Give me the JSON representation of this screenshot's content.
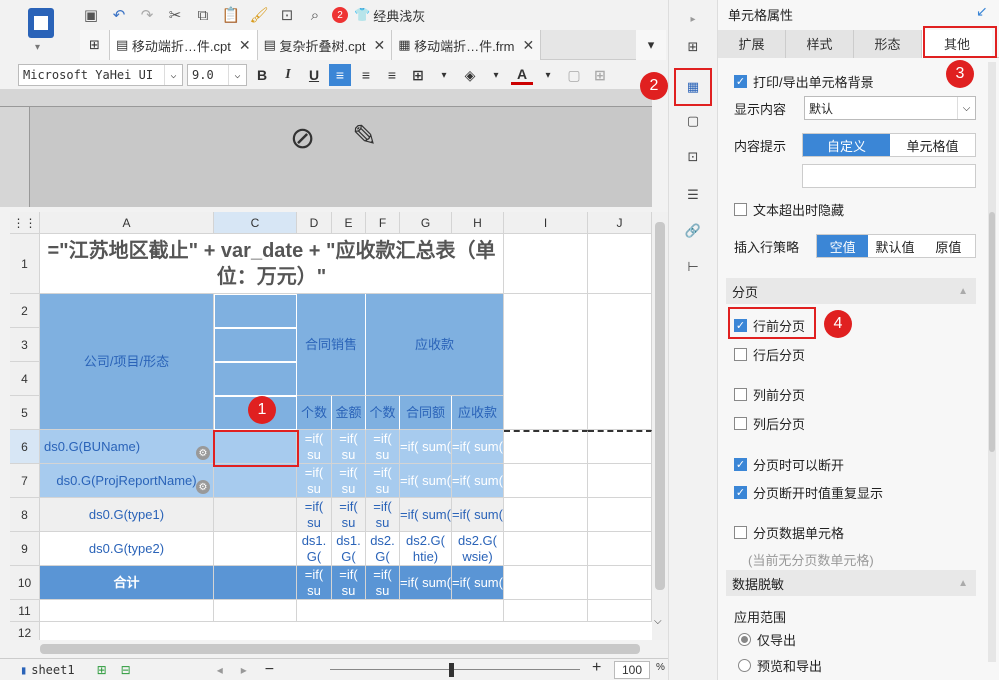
{
  "toolbar": {
    "red_count": "2",
    "classic_gray_label": "经典浅灰"
  },
  "tabs": [
    {
      "label": "移动端折…件.cpt"
    },
    {
      "label": "复杂折叠树.cpt"
    },
    {
      "label": "移动端折…件.frm"
    }
  ],
  "format_bar": {
    "font": "Microsoft YaHei UI",
    "size": "9.0",
    "bold": "B",
    "italic": "I",
    "underline": "U",
    "color_letter": "A"
  },
  "sheet": {
    "col_headers": [
      "A",
      "C",
      "D",
      "E",
      "F",
      "G",
      "H",
      "I",
      "J"
    ],
    "row_headers": [
      "1",
      "2",
      "3",
      "4",
      "5",
      "6",
      "7",
      "8",
      "9",
      "10",
      "11",
      "12"
    ],
    "title": "=\"江苏地区截止\" + var_date + \"应收款汇总表（单位：万元）\"",
    "a_header": "公司/项目/形态",
    "contract_sales": "合同销售",
    "receivable": "应收款",
    "sub_count1": "个数",
    "sub_amount": "金额",
    "sub_count2": "个数",
    "sub_contract_amount": "合同额",
    "sub_receivable": "应收款",
    "a6": "ds0.G(BUName)",
    "a7": "ds0.G(ProjReportName)",
    "a8": "ds0.G(type1)",
    "a9": "ds0.G(type2)",
    "a10": "合计",
    "f_if": "=if( su",
    "f_ifsum": "=if( sum(",
    "d9": "ds1. G(",
    "e9": "ds1. G(",
    "f9": "ds2. G(",
    "g9": "ds2.G( htie)",
    "h9": "ds2.G( wsie)"
  },
  "bottom": {
    "sheet_name": "sheet1",
    "zoom": "100",
    "percent": "%"
  },
  "panel": {
    "title": "单元格属性",
    "tabs": [
      "扩展",
      "样式",
      "形态",
      "其他"
    ],
    "print_bg": "打印/导出单元格背景",
    "display_content_label": "显示内容",
    "display_content_value": "默认",
    "tooltip_label": "内容提示",
    "tooltip_options": [
      "自定义",
      "单元格值"
    ],
    "hide_overflow": "文本超出时隐藏",
    "insert_row_label": "插入行策略",
    "insert_row_options": [
      "空值",
      "默认值",
      "原值"
    ],
    "paging_section": "分页",
    "page_before_row": "行前分页",
    "page_after_row": "行后分页",
    "page_before_col": "列前分页",
    "page_after_col": "列后分页",
    "can_break": "分页时可以断开",
    "repeat_on_break": "分页断开时值重复显示",
    "paging_data_cell": "分页数据单元格",
    "no_paging_cell": "(当前无分页数单元格)",
    "masking_section": "数据脱敏",
    "apply_range": "应用范围",
    "export_only": "仅导出",
    "preview_export": "预览和导出"
  },
  "badges": [
    "1",
    "2",
    "3",
    "4"
  ]
}
